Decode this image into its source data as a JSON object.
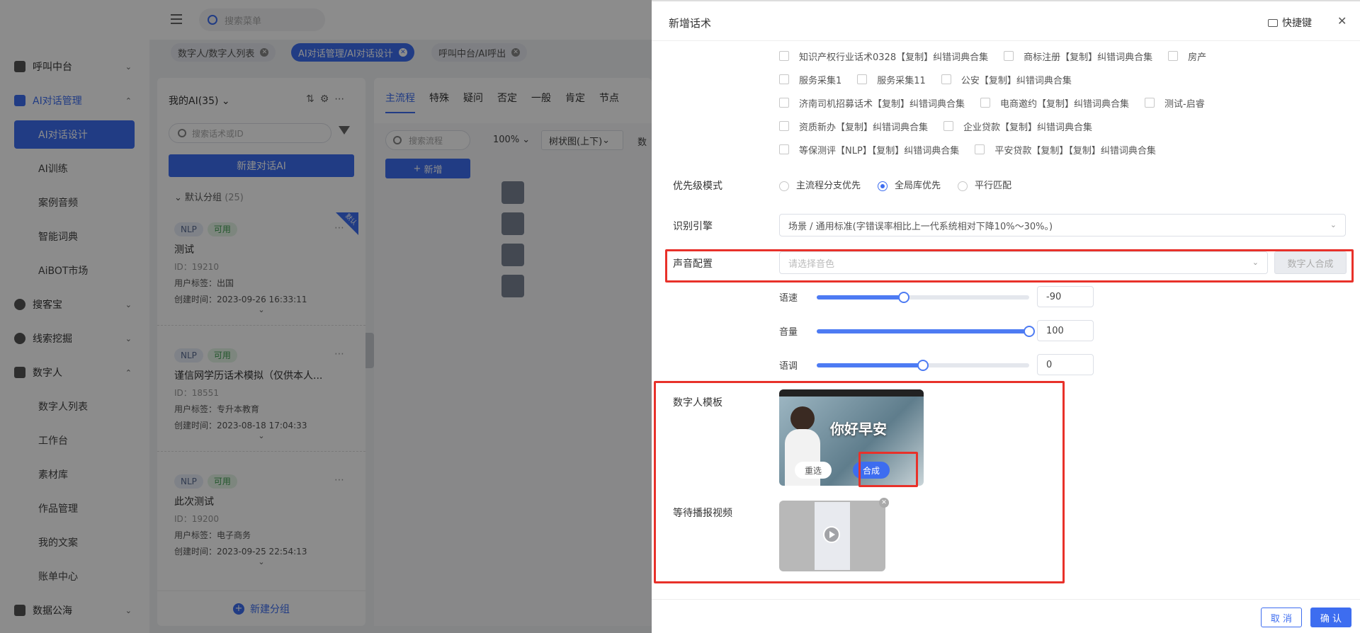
{
  "sidebar": {
    "items": [
      {
        "label": "呼叫中台"
      },
      {
        "label": "AI对话管理"
      },
      {
        "label": "AI对话设计"
      },
      {
        "label": "AI训练"
      },
      {
        "label": "案例音频"
      },
      {
        "label": "智能词典"
      },
      {
        "label": "AiBOT市场"
      },
      {
        "label": "搜客宝"
      },
      {
        "label": "线索挖掘"
      },
      {
        "label": "数字人"
      },
      {
        "label": "数字人列表"
      },
      {
        "label": "工作台"
      },
      {
        "label": "素材库"
      },
      {
        "label": "作品管理"
      },
      {
        "label": "我的文案"
      },
      {
        "label": "账单中心"
      },
      {
        "label": "数据公海"
      }
    ]
  },
  "topbar": {
    "search_placeholder": "搜索菜单"
  },
  "tabs": [
    {
      "label": "数字人/数字人列表"
    },
    {
      "label": "AI对话管理/AI对话设计"
    },
    {
      "label": "呼叫中台/AI呼出"
    }
  ],
  "ai_panel": {
    "title": "我的AI(35)",
    "search_placeholder": "搜索话术或ID",
    "new_button": "新建对话AI",
    "group_label": "默认分组",
    "group_count": "(25)",
    "default_ribbon": "默认",
    "add_group": "新建分组",
    "cards": [
      {
        "type": "NLP",
        "status": "可用",
        "name": "测试",
        "id": "ID：19210",
        "tags": "用户标签：出国",
        "created": "创建时间：2023-09-26 16:33:11"
      },
      {
        "type": "NLP",
        "status": "可用",
        "name": "谨信网学历话术模拟（仅供本人...",
        "id": "ID：18551",
        "tags": "用户标签：专升本教育",
        "created": "创建时间：2023-08-18 17:04:33"
      },
      {
        "type": "NLP",
        "status": "可用",
        "name": "此次测试",
        "id": "ID：19200",
        "tags": "用户标签：电子商务",
        "created": "创建时间：2023-09-25 22:54:13"
      }
    ]
  },
  "flow": {
    "tabs": [
      "主流程",
      "特殊",
      "疑问",
      "否定",
      "一般",
      "肯定",
      "节点"
    ],
    "search_placeholder": "搜索流程",
    "zoom": "100%",
    "layout": "树状图(上下)",
    "extra": "数",
    "add_button": "新增"
  },
  "drawer": {
    "title": "新增话术",
    "shortcut": "快捷键",
    "checkbox_rows": [
      [
        "知识产权行业话术0328【复制】纠错词典合集",
        "商标注册【复制】纠错词典合集",
        "房产"
      ],
      [
        "服务采集1",
        "服务采集11",
        "公安【复制】纠错词典合集"
      ],
      [
        "济南司机招募话术【复制】纠错词典合集",
        "电商邀约【复制】纠错词典合集",
        "测试-启睿"
      ],
      [
        "资质新办【复制】纠错词典合集",
        "企业贷款【复制】纠错词典合集"
      ],
      [
        "等保测评【NLP】【复制】纠错词典合集",
        "平安贷款【复制】【复制】纠错词典合集"
      ]
    ],
    "priority": {
      "label": "优先级模式",
      "options": [
        "主流程分支优先",
        "全局库优先",
        "平行匹配"
      ],
      "selected": "全局库优先"
    },
    "engine": {
      "label": "识别引擎",
      "value": "场景 / 通用标准(字错误率相比上一代系统相对下降10%～30%。)"
    },
    "voice": {
      "label": "声音配置",
      "placeholder": "请选择音色",
      "synth_button": "数字人合成"
    },
    "sliders": [
      {
        "label": "语速",
        "value": "-90",
        "fraction": 0.41
      },
      {
        "label": "音量",
        "value": "100",
        "fraction": 1.0
      },
      {
        "label": "语调",
        "value": "0",
        "fraction": 0.5
      }
    ],
    "template": {
      "label": "数字人模板",
      "overlay_text": "你好早安",
      "reselect": "重选",
      "synthesize": "合成"
    },
    "wait_video": {
      "label": "等待播报视频"
    },
    "footer": {
      "cancel": "取 消",
      "confirm": "确 认"
    }
  },
  "colors": {
    "primary": "#3d6df0",
    "highlight": "#e8312a"
  }
}
